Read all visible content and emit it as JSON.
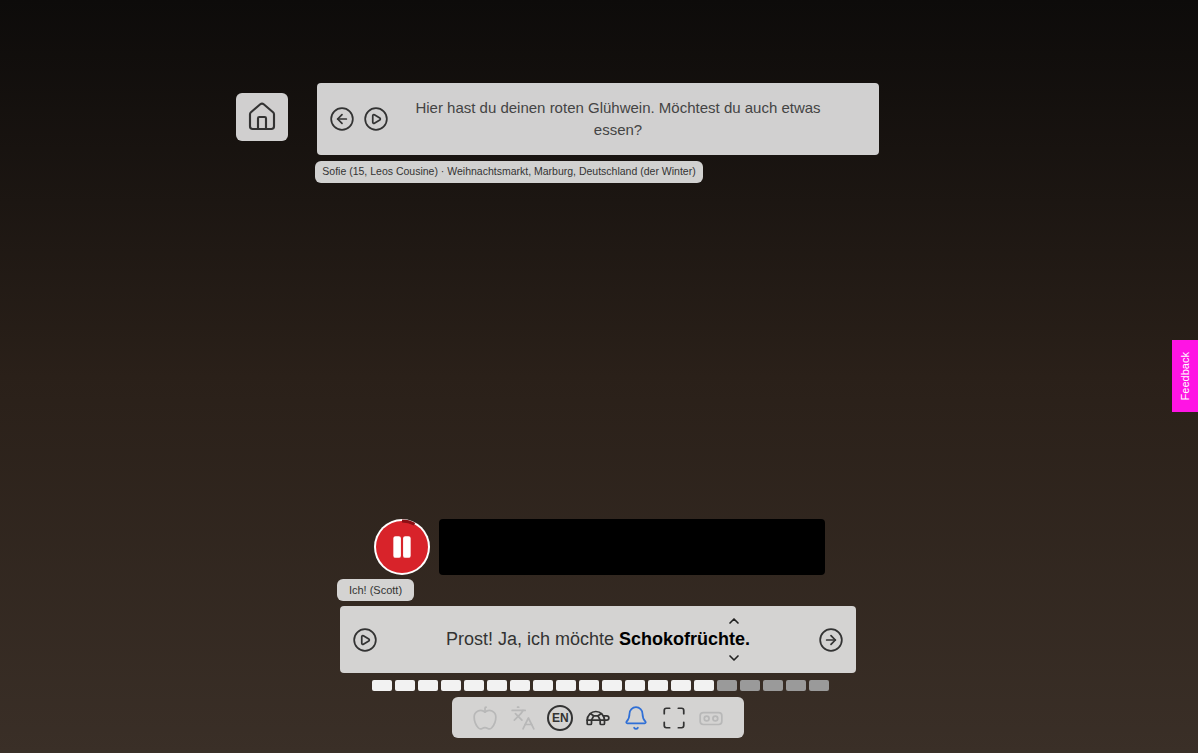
{
  "prompt": {
    "text": "Hier hast du deinen roten Glühwein. Möchtest du auch etwas essen?"
  },
  "speaker": "Sofie (15, Leos Cousine) · Weihnachtsmarkt, Marburg, Deutschland (der Winter)",
  "recorder": {
    "playing": true,
    "level": 0.08
  },
  "responder": "Ich! (Scott)",
  "response": {
    "text": "Prost! Ja, ich möchte ",
    "highlight": "Schokofrüchte."
  },
  "segments": [
    {
      "done": true
    },
    {
      "done": true
    },
    {
      "done": true
    },
    {
      "done": true
    },
    {
      "done": true
    },
    {
      "done": true
    },
    {
      "done": true
    },
    {
      "done": true
    },
    {
      "done": true
    },
    {
      "done": true
    },
    {
      "done": true
    },
    {
      "done": true
    },
    {
      "done": true
    },
    {
      "done": true
    },
    {
      "done": true
    },
    {
      "done": false
    },
    {
      "done": false
    },
    {
      "done": false
    },
    {
      "done": false
    },
    {
      "done": false
    }
  ],
  "toolbar": [
    {
      "kind": "apple",
      "disabled": true,
      "active": false
    },
    {
      "kind": "translate",
      "disabled": true,
      "active": false
    },
    {
      "kind": "text",
      "label": "EN",
      "disabled": false,
      "active": false
    },
    {
      "kind": "turtle",
      "disabled": false,
      "active": false
    },
    {
      "kind": "bell",
      "disabled": false,
      "active": true
    },
    {
      "kind": "fullscreen",
      "disabled": false,
      "active": false
    },
    {
      "kind": "vr",
      "disabled": true,
      "active": false
    }
  ],
  "feedback": "Feedback"
}
